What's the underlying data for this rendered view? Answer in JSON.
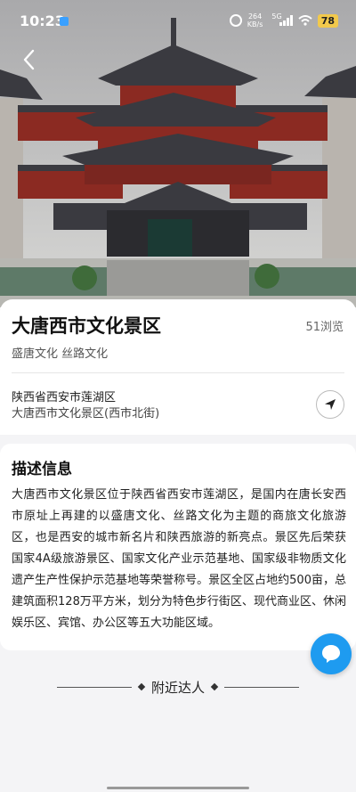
{
  "status_bar": {
    "time": "10:23",
    "net_speed_value": "264",
    "net_speed_unit": "KB/s",
    "network": "5G",
    "battery": "78"
  },
  "place": {
    "title": "大唐西市文化景区",
    "views": "51浏览",
    "tags": "盛唐文化 丝路文化",
    "address_line1": "陕西省西安市莲湖区",
    "address_line2": "大唐西市文化景区(西市北街)"
  },
  "description": {
    "heading": "描述信息",
    "text": "大唐西市文化景区位于陕西省西安市莲湖区，是国内在唐长安西市原址上再建的以盛唐文化、丝路文化为主题的商旅文化旅游区，也是西安的城市新名片和陕西旅游的新亮点。景区先后荣获国家4A级旅游景区、国家文化产业示范基地、国家级非物质文化遗产生产性保护示范基地等荣誉称号。景区全区占地约500亩，总建筑面积128万平方米，划分为特色步行街区、现代商业区、休闲娱乐区、宾馆、办公区等五大功能区域。"
  },
  "nearby": {
    "label": "附近达人"
  },
  "icons": {
    "back": "chevron-left-icon",
    "navigate": "navigation-arrow-icon",
    "chat": "chat-bubble-icon"
  },
  "colors": {
    "fab": "#1e9bf0",
    "battery": "#f2c94c",
    "roof": "#3a3a40",
    "wood": "#8b2a22"
  }
}
